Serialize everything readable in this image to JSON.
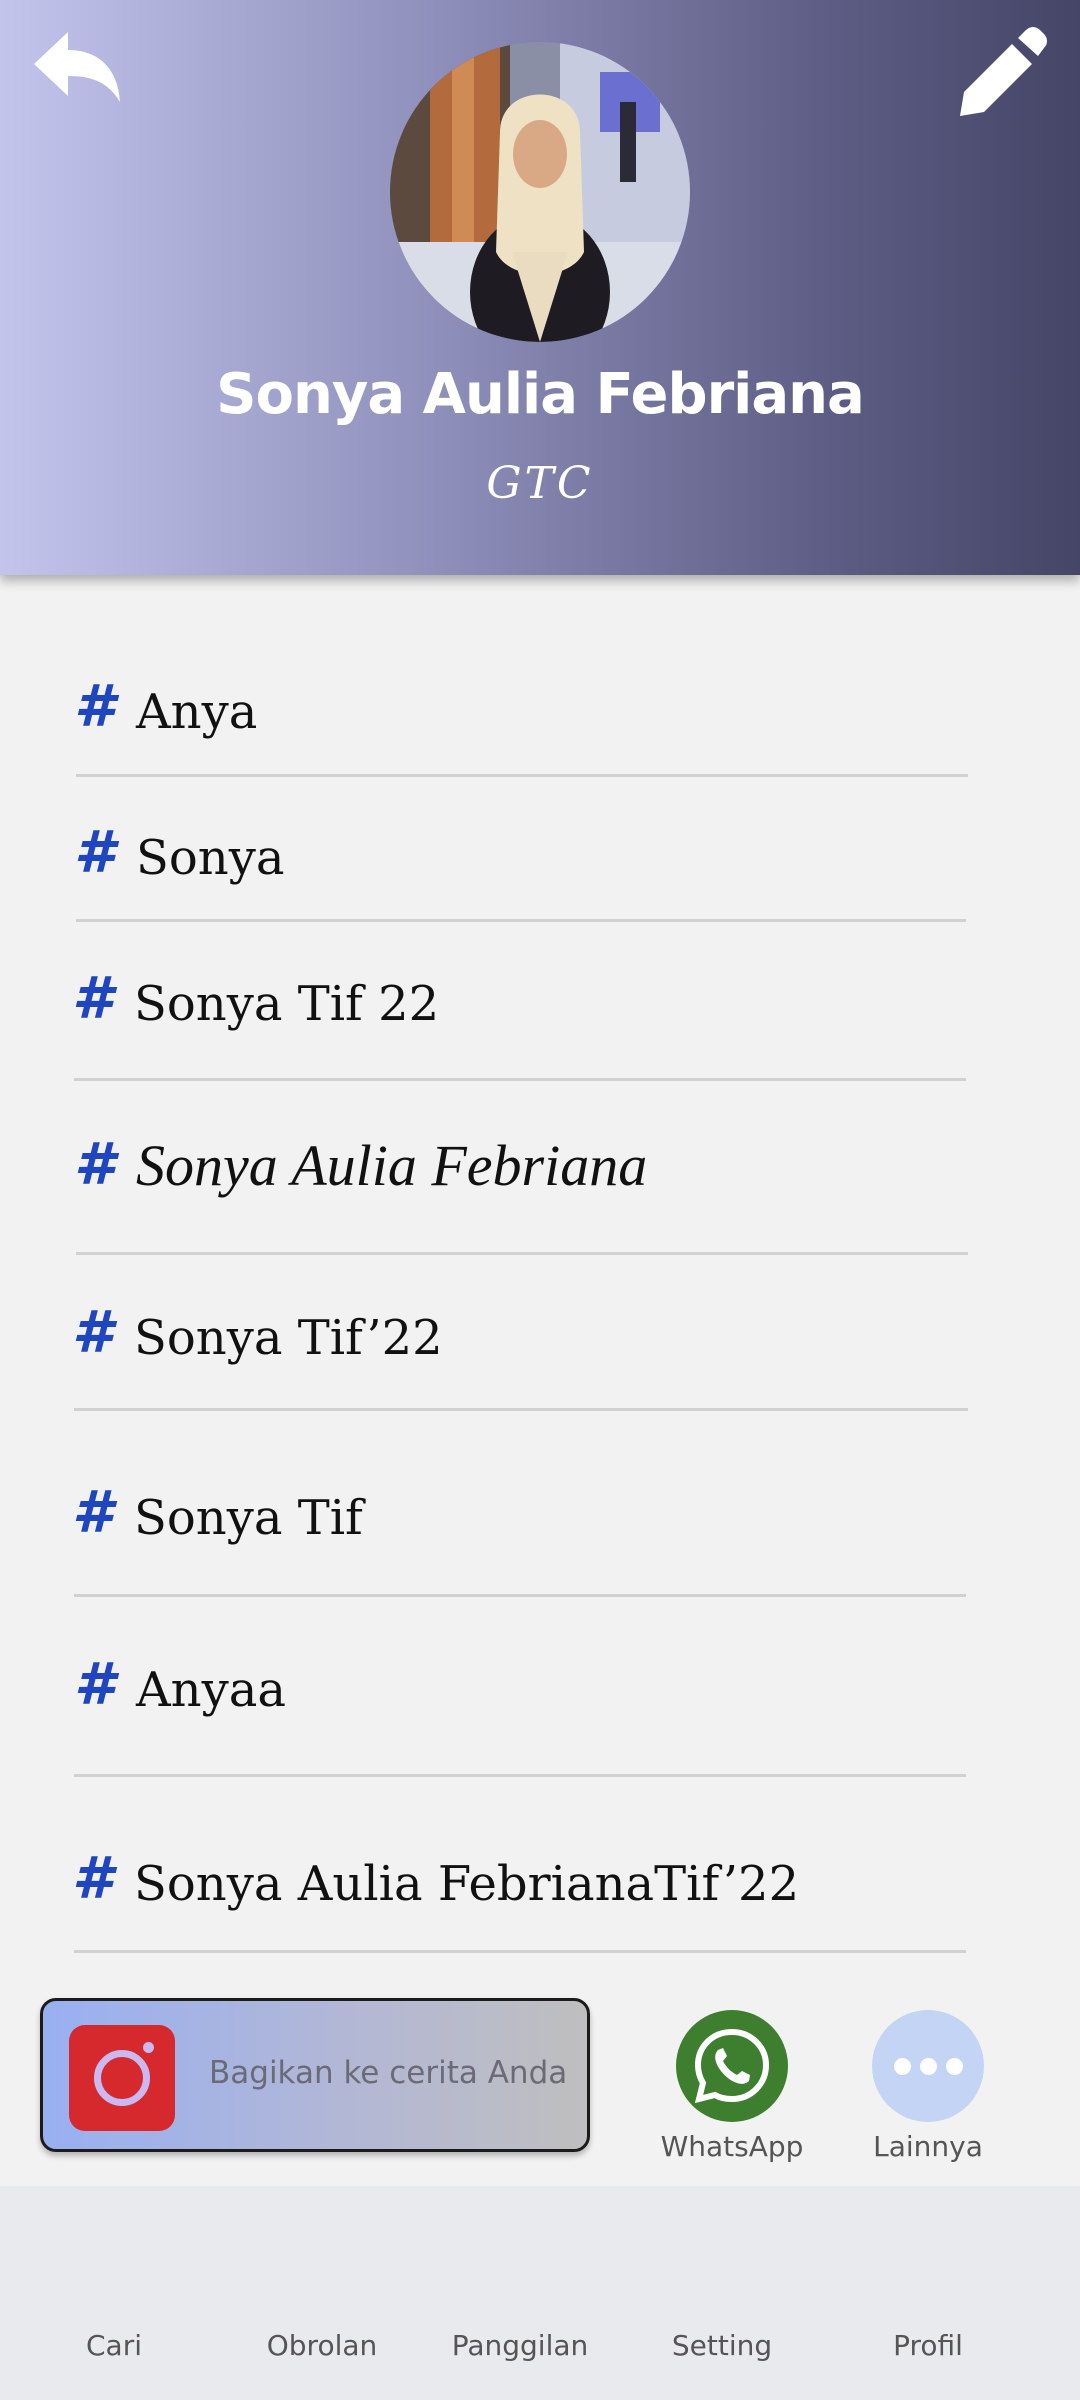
{
  "header": {
    "name": "Sonya Aulia Febriana",
    "subtitle": "GTC",
    "back_icon": "reply-arrow-icon",
    "edit_icon": "pencil-icon",
    "gradient": [
      "#c3c4ec",
      "#454567"
    ]
  },
  "tags": [
    {
      "hash": "#",
      "label": "Anya"
    },
    {
      "hash": "#",
      "label": "Sonya"
    },
    {
      "hash": "#",
      "label": "Sonya Tif 22"
    },
    {
      "hash": "#",
      "label": "Sonya Aulia Febriana"
    },
    {
      "hash": "#",
      "label": "Sonya Tif’22"
    },
    {
      "hash": "#",
      "label": "Sonya Tif"
    },
    {
      "hash": "#",
      "label": "Anyaa"
    },
    {
      "hash": "#",
      "label": "Sonya Aulia FebrianaTif’22"
    }
  ],
  "share": {
    "story_label": "Bagikan ke cerita Anda",
    "whatsapp_label": "WhatsApp",
    "more_label": "Lainnya"
  },
  "nav": [
    "Cari",
    "Obrolan",
    "Panggilan",
    "Setting",
    "Profil"
  ],
  "colors": {
    "accent": "#1f45bf",
    "whatsapp": "#3e7f2f",
    "instagram": "#d6292e"
  }
}
